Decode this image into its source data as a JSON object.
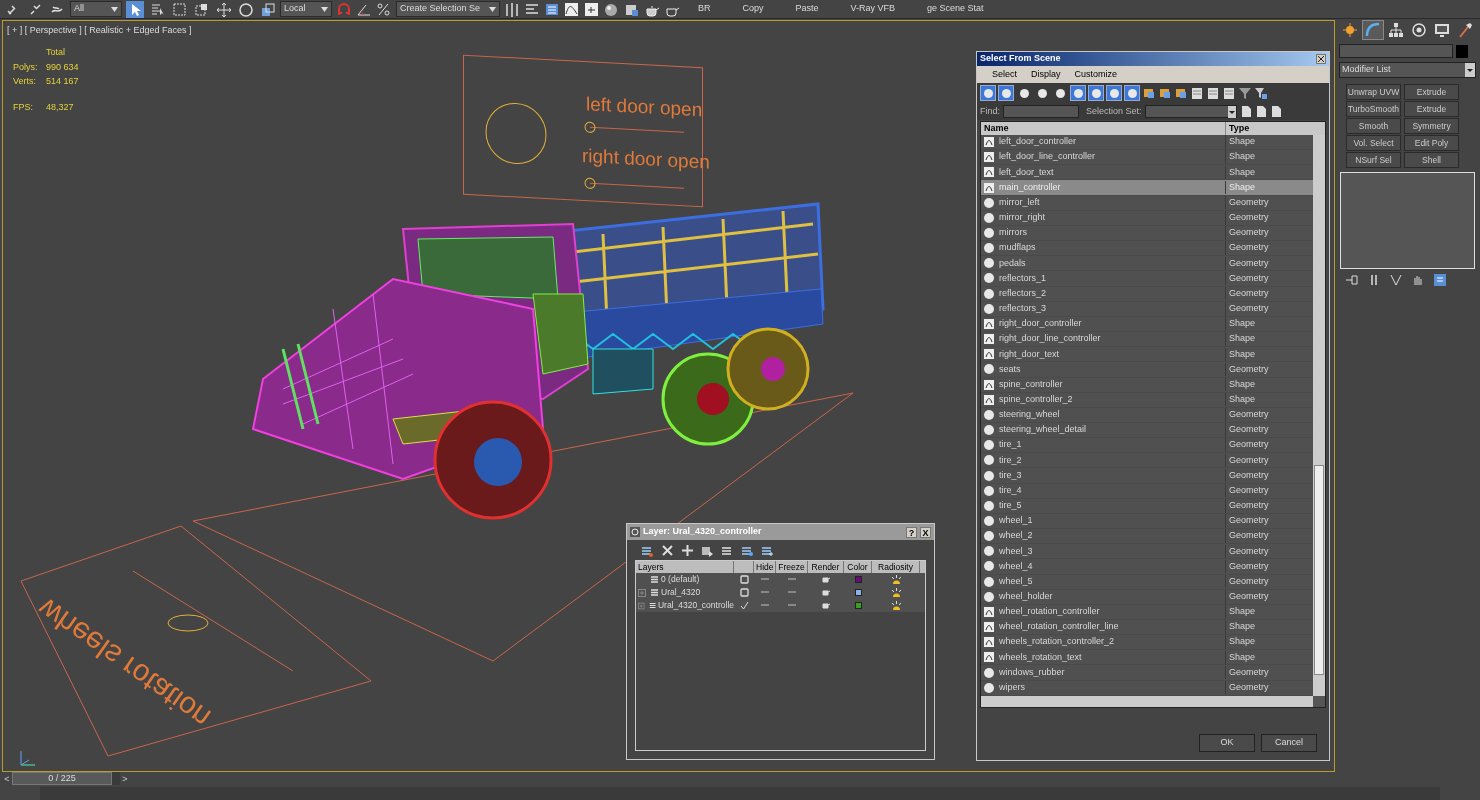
{
  "toolbar": {
    "selection_filter": "All",
    "coordinate_system": "Local",
    "selection_set": "Create Selection Se",
    "tools": [
      {
        "kind": "link",
        "selected": false
      },
      {
        "kind": "unlink",
        "selected": false
      },
      {
        "kind": "bind",
        "selected": false
      },
      {
        "kind": "select",
        "selected": true
      },
      {
        "kind": "select-name",
        "selected": false
      },
      {
        "kind": "rect",
        "selected": false
      },
      {
        "kind": "window",
        "selected": false
      },
      {
        "kind": "move",
        "selected": false
      },
      {
        "kind": "rotate",
        "selected": false
      },
      {
        "kind": "scale",
        "selected": false
      }
    ],
    "buttons": [
      "BR",
      "Copy",
      "Paste",
      "V-Ray VFB",
      "ge Scene Stat"
    ]
  },
  "viewport": {
    "label": "[ + ] [ Perspective ] [ Realistic + Edged Faces ]",
    "stats_header": "Total",
    "stats": [
      {
        "label": "Polys:",
        "value": "990 634"
      },
      {
        "label": "Verts:",
        "value": "514 167"
      },
      {
        "label": "FPS:",
        "value": "48,327"
      }
    ],
    "scene_texts": [
      "left door open",
      "right door open",
      "wheels rotation"
    ]
  },
  "select_from_scene": {
    "title": "Select From Scene",
    "menu": [
      "Select",
      "Display",
      "Customize"
    ],
    "filters": [
      {
        "selected": true
      },
      {
        "selected": true
      },
      {
        "selected": false
      },
      {
        "selected": false
      },
      {
        "selected": false
      },
      {
        "selected": true
      },
      {
        "selected": true
      },
      {
        "selected": true
      },
      {
        "selected": true
      }
    ],
    "find_label": "Find:",
    "selection_set_label": "Selection Set:",
    "columns": [
      "Name",
      "Type"
    ],
    "rows": [
      {
        "name": "left_door_controller",
        "type": "Shape",
        "kind": "shape",
        "selected": false
      },
      {
        "name": "left_door_line_controller",
        "type": "Shape",
        "kind": "shape",
        "selected": false
      },
      {
        "name": "left_door_text",
        "type": "Shape",
        "kind": "shape",
        "selected": false
      },
      {
        "name": "main_controller",
        "type": "Shape",
        "kind": "shape",
        "selected": true
      },
      {
        "name": "mirror_left",
        "type": "Geometry",
        "kind": "geometry",
        "selected": false
      },
      {
        "name": "mirror_right",
        "type": "Geometry",
        "kind": "geometry",
        "selected": false
      },
      {
        "name": "mirrors",
        "type": "Geometry",
        "kind": "geometry",
        "selected": false
      },
      {
        "name": "mudflaps",
        "type": "Geometry",
        "kind": "geometry",
        "selected": false
      },
      {
        "name": "pedals",
        "type": "Geometry",
        "kind": "geometry",
        "selected": false
      },
      {
        "name": "reflectors_1",
        "type": "Geometry",
        "kind": "geometry",
        "selected": false
      },
      {
        "name": "reflectors_2",
        "type": "Geometry",
        "kind": "geometry",
        "selected": false
      },
      {
        "name": "reflectors_3",
        "type": "Geometry",
        "kind": "geometry",
        "selected": false
      },
      {
        "name": "right_door_controller",
        "type": "Shape",
        "kind": "shape",
        "selected": false
      },
      {
        "name": "right_door_line_controller",
        "type": "Shape",
        "kind": "shape",
        "selected": false
      },
      {
        "name": "right_door_text",
        "type": "Shape",
        "kind": "shape",
        "selected": false
      },
      {
        "name": "seats",
        "type": "Geometry",
        "kind": "geometry",
        "selected": false
      },
      {
        "name": "spine_controller",
        "type": "Shape",
        "kind": "shape",
        "selected": false
      },
      {
        "name": "spine_controller_2",
        "type": "Shape",
        "kind": "shape",
        "selected": false
      },
      {
        "name": "steering_wheel",
        "type": "Geometry",
        "kind": "geometry",
        "selected": false
      },
      {
        "name": "steering_wheel_detail",
        "type": "Geometry",
        "kind": "geometry",
        "selected": false
      },
      {
        "name": "tire_1",
        "type": "Geometry",
        "kind": "geometry",
        "selected": false
      },
      {
        "name": "tire_2",
        "type": "Geometry",
        "kind": "geometry",
        "selected": false
      },
      {
        "name": "tire_3",
        "type": "Geometry",
        "kind": "geometry",
        "selected": false
      },
      {
        "name": "tire_4",
        "type": "Geometry",
        "kind": "geometry",
        "selected": false
      },
      {
        "name": "tire_5",
        "type": "Geometry",
        "kind": "geometry",
        "selected": false
      },
      {
        "name": "wheel_1",
        "type": "Geometry",
        "kind": "geometry",
        "selected": false
      },
      {
        "name": "wheel_2",
        "type": "Geometry",
        "kind": "geometry",
        "selected": false
      },
      {
        "name": "wheel_3",
        "type": "Geometry",
        "kind": "geometry",
        "selected": false
      },
      {
        "name": "wheel_4",
        "type": "Geometry",
        "kind": "geometry",
        "selected": false
      },
      {
        "name": "wheel_5",
        "type": "Geometry",
        "kind": "geometry",
        "selected": false
      },
      {
        "name": "wheel_holder",
        "type": "Geometry",
        "kind": "geometry",
        "selected": false
      },
      {
        "name": "wheel_rotation_controller",
        "type": "Shape",
        "kind": "shape",
        "selected": false
      },
      {
        "name": "wheel_rotation_controller_line",
        "type": "Shape",
        "kind": "shape",
        "selected": false
      },
      {
        "name": "wheels_rotation_controller_2",
        "type": "Shape",
        "kind": "shape",
        "selected": false
      },
      {
        "name": "wheels_rotation_text",
        "type": "Shape",
        "kind": "shape",
        "selected": false
      },
      {
        "name": "windows_rubber",
        "type": "Geometry",
        "kind": "geometry",
        "selected": false
      },
      {
        "name": "wipers",
        "type": "Geometry",
        "kind": "geometry",
        "selected": false
      }
    ],
    "buttons": [
      "OK",
      "Cancel"
    ]
  },
  "layer_dialog": {
    "title": "Layer: Ural_4320_controller",
    "help": "?",
    "close": "X",
    "columns": [
      "Layers",
      "Hide",
      "Freeze",
      "Render",
      "Color",
      "Radiosity"
    ],
    "layers": [
      {
        "name": "0 (default)",
        "current": false,
        "expandable": false,
        "color": "#6a0d7a"
      },
      {
        "name": "Ural_4320",
        "current": false,
        "expandable": true,
        "color": "#8ab4e8"
      },
      {
        "name": "Ural_4320_controlle",
        "current": true,
        "expandable": true,
        "color": "#3aa020"
      }
    ]
  },
  "command_panel": {
    "tabs": [
      {
        "kind": "create",
        "selected": false
      },
      {
        "kind": "modify",
        "selected": true
      },
      {
        "kind": "hierarchy",
        "selected": false
      },
      {
        "kind": "motion",
        "selected": false
      },
      {
        "kind": "display",
        "selected": false
      },
      {
        "kind": "utilities",
        "selected": false
      }
    ],
    "modifier_list": "Modifier List",
    "modifiers": [
      "Unwrap UVW",
      "Extrude",
      "TurboSmooth",
      "Extrude",
      "Smooth",
      "Symmetry",
      "Vol. Select",
      "Edit Poly",
      "NSurf Sel",
      "Shell"
    ]
  },
  "timeline": {
    "previous": "<",
    "frame": "0 / 225",
    "next": ">",
    "level": 0
  }
}
